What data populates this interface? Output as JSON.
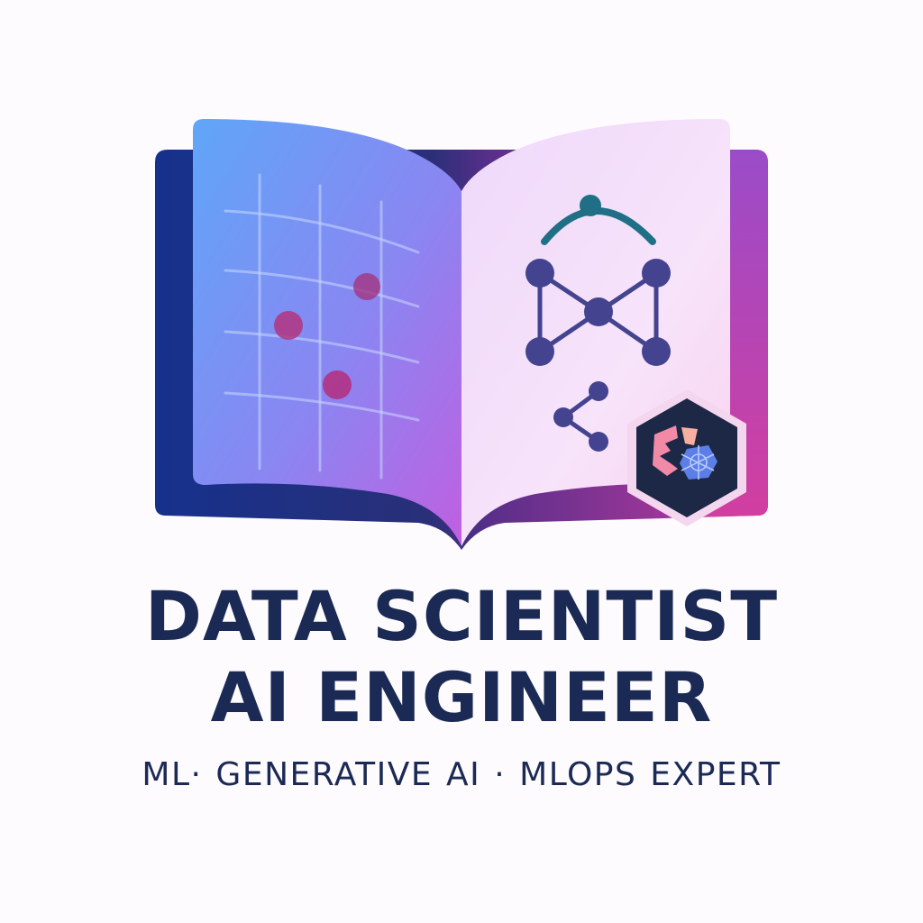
{
  "title": {
    "line1": "DATA SCIENTIST",
    "line2": "AI ENGINEER"
  },
  "tagline": "ML· GENERATIVE AI · MLOPS EXPERT",
  "icons": {
    "book": "open-book-icon",
    "chart": "scatter-chart-icon",
    "network": "neural-network-icon",
    "share": "share-icon",
    "badge": "hexagon-badge-icon"
  },
  "colors": {
    "text": "#1b2a55",
    "book_left_start": "#5fa6f8",
    "book_left_end": "#b266e8",
    "book_cover_left": "#16318c",
    "book_cover_right": "#c43aa0",
    "node": "#44438f",
    "arc": "#1f6f86",
    "point": "#a2357f",
    "badge": "#1d2746"
  }
}
